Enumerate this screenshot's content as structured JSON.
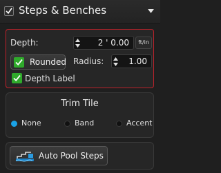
{
  "header": {
    "title": "Steps & Benches",
    "enabled": true
  },
  "depth": {
    "label": "Depth:",
    "value": "2 ' 0.00",
    "unit": "ft/in",
    "rounded_label": "Rounded",
    "rounded_checked": true,
    "radius_label": "Radius:",
    "radius_value": "1.00",
    "depth_label_text": "Depth Label",
    "depth_label_checked": true
  },
  "trim": {
    "title": "Trim Tile",
    "options": [
      "None",
      "Band",
      "Accent"
    ],
    "selected": "None"
  },
  "auto_steps": {
    "label": "Auto Pool Steps"
  },
  "colors": {
    "accent_red": "#c0222b",
    "check_green": "#2faa2b",
    "radio_blue": "#1aa2e6"
  }
}
